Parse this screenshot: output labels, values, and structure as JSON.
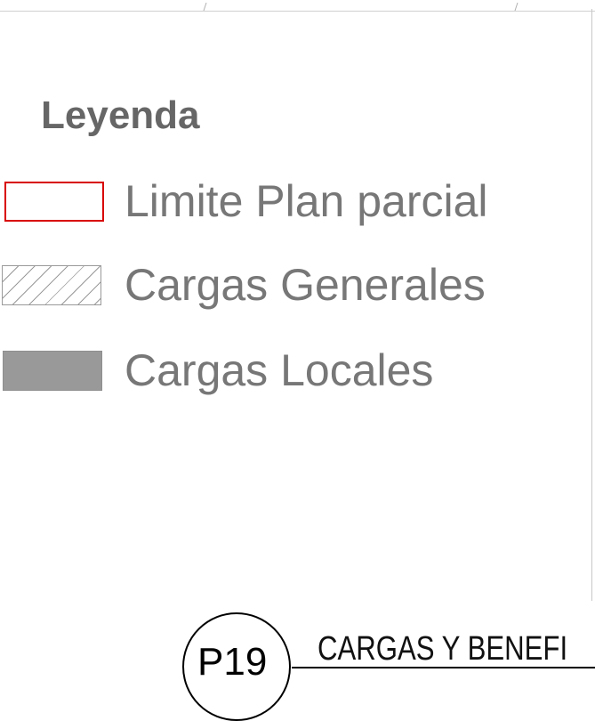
{
  "legend": {
    "title": "Leyenda",
    "items": [
      {
        "label": "Limite Plan parcial",
        "symbol": "red-outline",
        "color": "#d80000"
      },
      {
        "label": "Cargas Generales",
        "symbol": "diagonal-hatch",
        "color": "#9a9a9a"
      },
      {
        "label": "Cargas Locales",
        "symbol": "solid-gray-fill",
        "color": "#999999"
      }
    ]
  },
  "title_block": {
    "sheet_id": "P19",
    "title": "CARGAS Y BENEFI"
  }
}
